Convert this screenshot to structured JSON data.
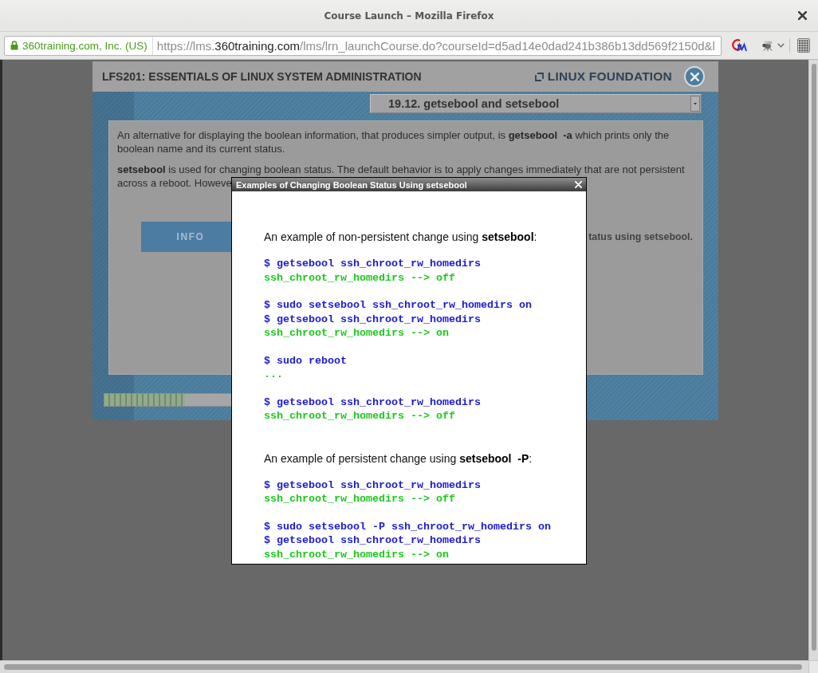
{
  "window": {
    "title": "Course Launch – Mozilla Firefox"
  },
  "address_bar": {
    "site_identity": "360training.com, Inc. (US)",
    "url": {
      "prefix": "https://lms.",
      "domain": "360training.com",
      "path": "/lms/lrn_launchCourse.do?courseId=d5ad14e0dad241b386b13dd569f2150d&l"
    }
  },
  "course": {
    "title": "LFS201: ESSENTIALS OF LINUX SYSTEM ADMINISTRATION",
    "logo_text": "LINUX FOUNDATION",
    "topic_select": {
      "value": "19.12. getsebool and setsebool"
    },
    "paragraphs": [
      {
        "kind": "text",
        "text": "An alternative for displaying the boolean information, that produces simpler output, is **getsebool  -a** which prints only the boolean name and its current status."
      },
      {
        "kind": "cut",
        "lines": [
          "**setsebool** is used for changing boolean status. The default behavior is to apply changes immediately that are not persistent",
          "across a reboot. Howeve"
        ]
      }
    ],
    "tab": {
      "label": "INFO"
    },
    "heading_fragment": "tatus using setsebool.",
    "progress": {
      "level": 0.255
    }
  },
  "dialog": {
    "title": "Examples of Changing Boolean Status Using setsebool",
    "sections": [
      {
        "intro": "An example of non-persistent change using **setsebool**:",
        "blocks": [
          {
            "lines": [
              {
                "kind": "command",
                "text": "$ getsebool ssh_chroot_rw_homedirs"
              },
              {
                "kind": "output",
                "text": "ssh_chroot_rw_homedirs --> off"
              }
            ]
          },
          {
            "lines": [
              {
                "kind": "command",
                "text": "$ sudo setsebool ssh_chroot_rw_homedirs on"
              },
              {
                "kind": "command",
                "text": "$ getsebool ssh_chroot_rw_homedirs"
              },
              {
                "kind": "output",
                "text": "ssh_chroot_rw_homedirs --> on"
              }
            ]
          },
          {
            "lines": [
              {
                "kind": "command",
                "text": "$ sudo reboot"
              },
              {
                "kind": "output",
                "text": "..."
              }
            ]
          },
          {
            "lines": [
              {
                "kind": "command",
                "text": "$ getsebool ssh_chroot_rw_homedirs"
              },
              {
                "kind": "output",
                "text": "ssh_chroot_rw_homedirs --> off"
              }
            ]
          }
        ]
      },
      {
        "intro": "An example of persistent change using **setsebool  -P**:",
        "blocks": [
          {
            "lines": [
              {
                "kind": "command",
                "text": "$ getsebool ssh_chroot_rw_homedirs"
              },
              {
                "kind": "output",
                "text": "ssh_chroot_rw_homedirs --> off"
              }
            ]
          },
          {
            "lines": [
              {
                "kind": "command",
                "text": "$ sudo setsebool -P ssh_chroot_rw_homedirs on"
              },
              {
                "kind": "command",
                "text": "$ getsebool ssh_chroot_rw_homedirs"
              },
              {
                "kind": "output",
                "text": "ssh_chroot_rw_homedirs --> on"
              }
            ]
          }
        ]
      }
    ]
  }
}
